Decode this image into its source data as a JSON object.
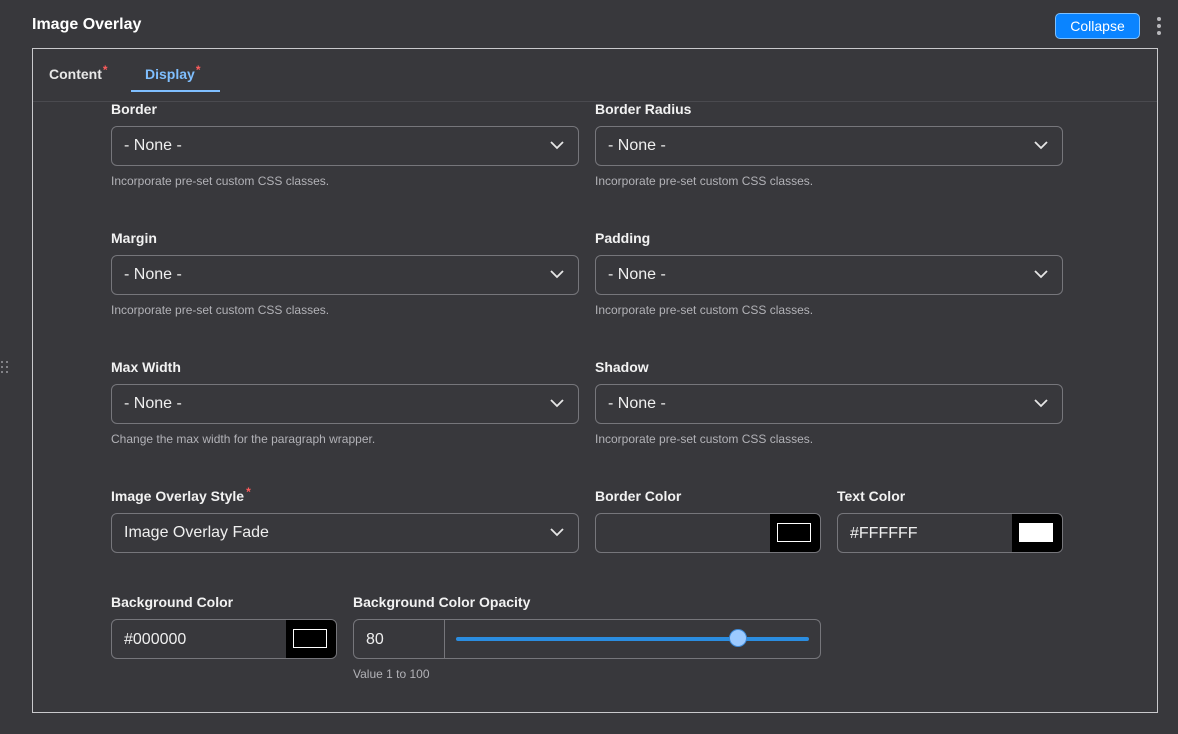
{
  "header": {
    "title": "Image Overlay",
    "collapse_label": "Collapse"
  },
  "tabs": [
    {
      "label": "Content",
      "required": "*"
    },
    {
      "label": "Display",
      "required": "*"
    }
  ],
  "fields": {
    "border": {
      "label": "Border",
      "value": "- None -",
      "help": "Incorporate pre-set custom CSS classes."
    },
    "border_radius": {
      "label": "Border Radius",
      "value": "- None -",
      "help": "Incorporate pre-set custom CSS classes."
    },
    "margin": {
      "label": "Margin",
      "value": "- None -",
      "help": "Incorporate pre-set custom CSS classes."
    },
    "padding": {
      "label": "Padding",
      "value": "- None -",
      "help": "Incorporate pre-set custom CSS classes."
    },
    "max_width": {
      "label": "Max Width",
      "value": "- None -",
      "help": "Change the max width for the paragraph wrapper."
    },
    "shadow": {
      "label": "Shadow",
      "value": "- None -",
      "help": "Incorporate pre-set custom CSS classes."
    },
    "overlay_style": {
      "label": "Image Overlay Style",
      "required": "*",
      "value": "Image Overlay Fade"
    },
    "border_color": {
      "label": "Border Color",
      "value": "",
      "swatch": "#000000"
    },
    "text_color": {
      "label": "Text Color",
      "value": "#FFFFFF",
      "swatch": "#FFFFFF"
    },
    "background_color": {
      "label": "Background Color",
      "value": "#000000",
      "swatch": "#000000"
    },
    "bg_opacity": {
      "label": "Background Color Opacity",
      "value": "80",
      "min": 1,
      "max": 100,
      "help": "Value 1 to 100"
    }
  },
  "colors": {
    "accent": "#0a84ff",
    "tab_active": "#7fbfff",
    "required": "#ff5c5c",
    "background": "#38383c"
  }
}
